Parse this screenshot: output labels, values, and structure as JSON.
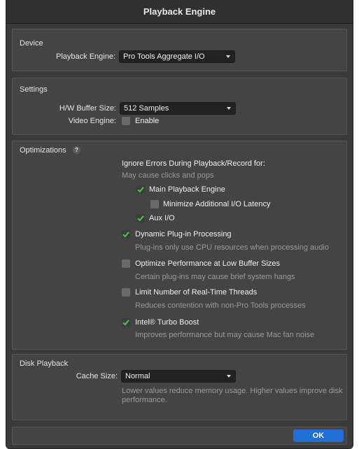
{
  "window": {
    "title": "Playback Engine"
  },
  "device": {
    "section_title": "Device",
    "playback_engine_label": "Playback Engine:",
    "playback_engine_value": "Pro Tools Aggregate I/O"
  },
  "settings": {
    "section_title": "Settings",
    "buffer_label": "H/W Buffer Size:",
    "buffer_value": "512 Samples",
    "video_label": "Video Engine:",
    "video_enable_label": "Enable",
    "video_enabled": false
  },
  "optimizations": {
    "section_title": "Optimizations",
    "help_icon": "?",
    "ignore_errors_heading": "Ignore Errors During Playback/Record for:",
    "ignore_errors_hint": "May cause clicks and pops",
    "main_playback_label": "Main Playback Engine",
    "main_playback_checked": true,
    "minimize_latency_label": "Minimize Additional I/O Latency",
    "minimize_latency_checked": false,
    "aux_io_label": "Aux I/O",
    "aux_io_checked": true,
    "dynamic_plugin_label": "Dynamic Plug-in Processing",
    "dynamic_plugin_checked": true,
    "dynamic_plugin_hint": "Plug-ins only use CPU resources when processing audio",
    "optimize_low_buffer_label": "Optimize Performance at Low Buffer Sizes",
    "optimize_low_buffer_checked": false,
    "optimize_low_buffer_hint": "Certain plug-ins may cause brief system hangs",
    "limit_threads_label": "Limit Number of Real-Time Threads",
    "limit_threads_checked": false,
    "limit_threads_hint": "Reduces contention with non-Pro Tools processes",
    "turbo_boost_label": "Intel® Turbo Boost",
    "turbo_boost_checked": true,
    "turbo_boost_hint": "Improves performance but may cause Mac fan noise"
  },
  "disk_playback": {
    "section_title": "Disk Playback",
    "cache_label": "Cache Size:",
    "cache_value": "Normal",
    "cache_hint_line1": "Lower values reduce memory usage. Higher values improve disk",
    "cache_hint_line2": "performance."
  },
  "footer": {
    "ok_label": "OK"
  },
  "colors": {
    "accent": "#1f6fd6",
    "check": "#4ec24e",
    "panel": "#444444",
    "background": "#3a3a3a"
  }
}
